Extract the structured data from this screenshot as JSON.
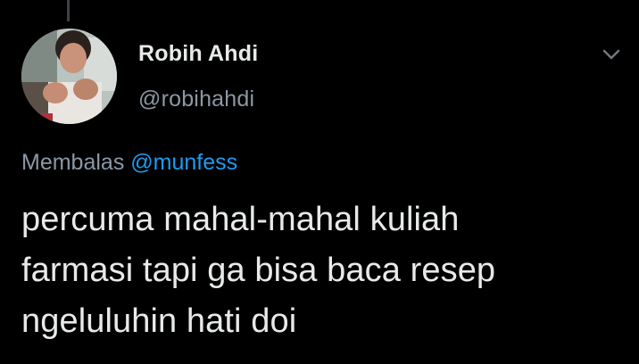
{
  "author": {
    "name": "Robih Ahdi",
    "handle": "@robihahdi"
  },
  "reply": {
    "prefix": "Membalas",
    "mention": "@munfess"
  },
  "tweet": {
    "lines": [
      "percuma mahal-mahal kuliah",
      "farmasi tapi ga bisa baca resep",
      "ngeluluhin hati doi"
    ]
  },
  "icons": {
    "menu": "chevron-down-icon"
  },
  "colors": {
    "background": "#000000",
    "primary_text": "#e7e9ea",
    "secondary_text": "#8b98a5",
    "accent": "#1d9bf0"
  }
}
